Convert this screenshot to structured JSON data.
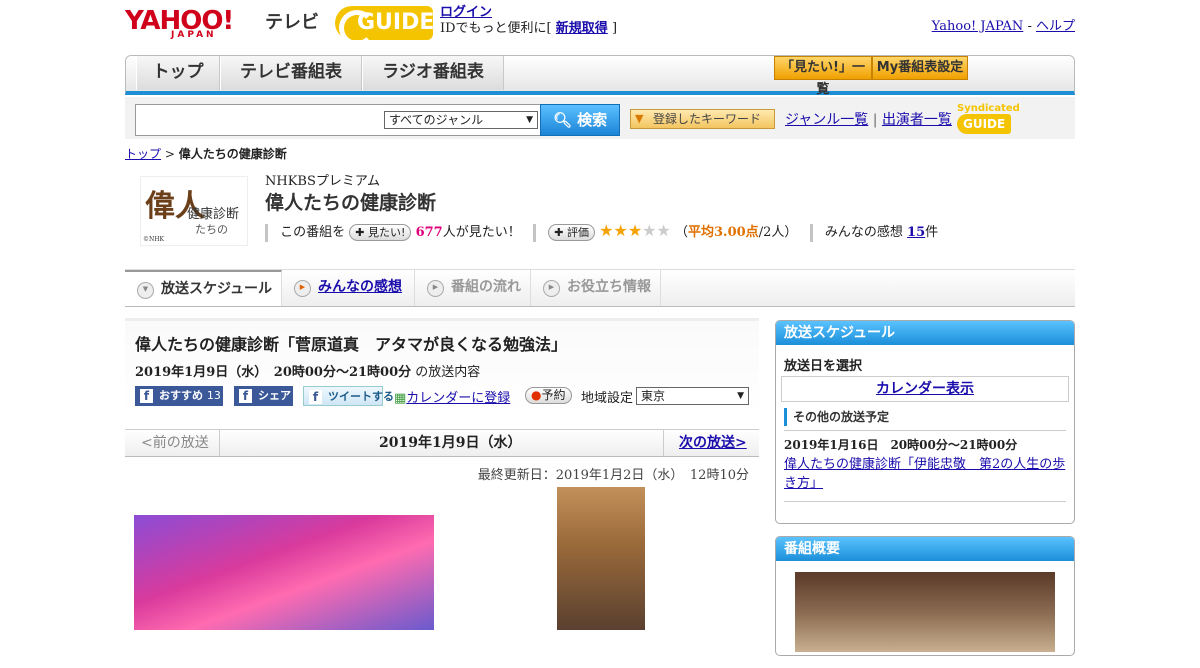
{
  "header": {
    "yahoo_logo": "YAHOO!",
    "yahoo_sub": "JAPAN",
    "tv_label": "テレビ",
    "gguide_logo": "GUIDE",
    "login_label": "ログイン",
    "login_note": "IDでもっと便利に[",
    "register_label": "新規取得",
    "login_note_end": "]",
    "yahoo_japan_link": "Yahoo! JAPAN",
    "sep": "-",
    "help_link": "ヘルプ"
  },
  "nav": {
    "tabs": [
      "トップ",
      "テレビ番組表",
      "ラジオ番組表"
    ],
    "mitai_list": "「見たい!」一覧",
    "my_settings": "My番組表設定"
  },
  "search": {
    "placeholder": "",
    "genre_selected": "すべてのジャンル",
    "search_button": "検索",
    "keyword_button": "登録したキーワード",
    "genre_list": "ジャンル一覧",
    "divider": "|",
    "performer_list": "出演者一覧",
    "syndicated": "Syndicated",
    "gguide_small": "GUIDE"
  },
  "breadcrumb": {
    "top": "トップ",
    "sep": ">",
    "current": "偉人たちの健康診断"
  },
  "program": {
    "logo_big": "偉人",
    "logo_text": "健康診断",
    "logo_text2": "たちの",
    "logo_credit": "©NHK",
    "channel": "NHKBSプレミアム",
    "title": "偉人たちの健康診断",
    "mitai_prefix": "この番組を",
    "mitai_button": "見たい!",
    "mitai_count": "677",
    "mitai_suffix": "人が見たい！",
    "rate_button": "評価",
    "stars_filled": 3,
    "stars_total": 5,
    "rating_open": "（",
    "rating_avg": "平均3.00点",
    "rating_count": "/2人）",
    "reviews_label": "みんなの感想",
    "reviews_count": "15",
    "reviews_unit": "件"
  },
  "subtabs": [
    "放送スケジュール",
    "みんなの感想",
    "番組の流れ",
    "お役立ち情報"
  ],
  "episode": {
    "title": "偉人たちの健康診断「菅原道真　アタマが良くなる勉強法」",
    "datetime": "2019年1月9日（水）　20時00分～21時00分",
    "datetime_suffix": "の放送内容",
    "recommend": "おすすめ",
    "recommend_count": "13",
    "share": "シェア",
    "tweet": "ツイートする",
    "calendar": "カレンダーに登録",
    "reserve": "予約",
    "region_label": "地域設定",
    "region_value": "東京",
    "prev": "<前の放送",
    "current_date": "2019年1月9日（水）",
    "next": "次の放送>",
    "updated": "最終更新日：2019年1月2日（水）　12時10分"
  },
  "sidebar": {
    "schedule_header": "放送スケジュール",
    "select_date": "放送日を選択",
    "calendar_link": "カレンダー表示",
    "other_header": "その他の放送予定",
    "other_datetime": "2019年1月16日　20時00分～21時00分",
    "other_title": "偉人たちの健康診断「伊能忠敬　第2の人生の歩き方」",
    "overview_header": "番組概要"
  },
  "colors": {
    "accent_blue": "#1b8fd9",
    "yahoo_red": "#d0021b",
    "gguide_yellow": "#f5c400",
    "rating_orange": "#e07000",
    "count_pink": "#e0007a"
  }
}
